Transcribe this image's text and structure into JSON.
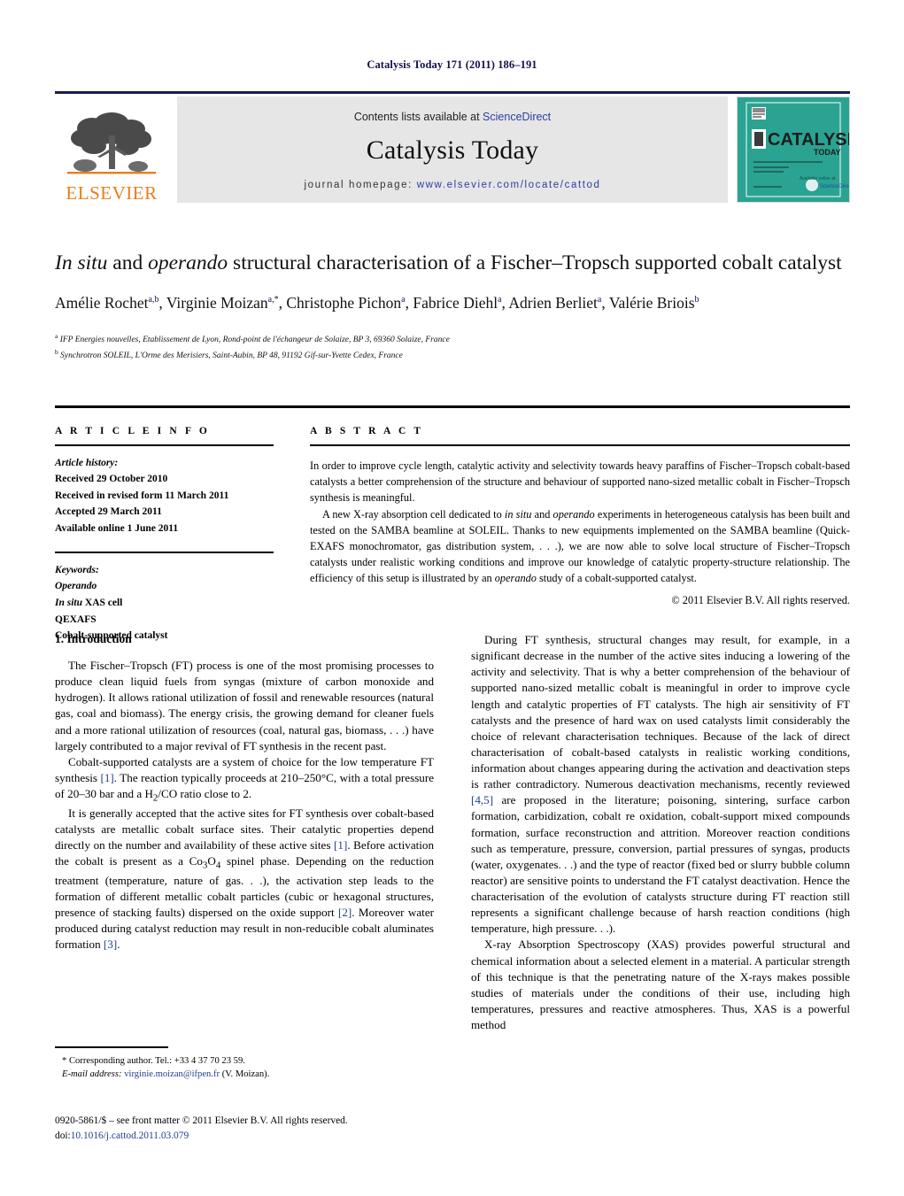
{
  "running_head": "Catalysis Today 171 (2011) 186–191",
  "masthead": {
    "contents_prefix": "Contents lists available at ",
    "contents_link": "ScienceDirect",
    "journal_title": "Catalysis Today",
    "homepage_prefix": "journal homepage: ",
    "homepage_link": "www.elsevier.com/locate/cattod",
    "publisher_logo_text": "ELSEVIER",
    "cover": {
      "title": "CATALYSIS",
      "subtitle": "TODAY",
      "accent_color": "#2aa392"
    }
  },
  "article": {
    "title_part1": "In situ",
    "title_part2": " and ",
    "title_part3": "operando",
    "title_part4": " structural characterisation of a Fischer–Tropsch supported cobalt catalyst",
    "authors": [
      {
        "name": "Amélie Rochet",
        "sup": "a,b"
      },
      {
        "name": "Virginie Moizan",
        "sup": "a,*"
      },
      {
        "name": "Christophe Pichon",
        "sup": "a"
      },
      {
        "name": "Fabrice Diehl",
        "sup": "a"
      },
      {
        "name": "Adrien Berliet",
        "sup": "a"
      },
      {
        "name": "Valérie Briois",
        "sup": "b"
      }
    ],
    "affiliations": [
      {
        "marker": "a",
        "text": "IFP Energies nouvelles, Etablissement de Lyon, Rond-point de l'échangeur de Solaize, BP 3, 69360 Solaize, France"
      },
      {
        "marker": "b",
        "text": "Synchrotron SOLEIL, L'Orme des Merisiers, Saint-Aubin, BP 48, 91192 Gif-sur-Yvette Cedex, France"
      }
    ]
  },
  "article_info": {
    "heading": "A R T I C L E   I N F O",
    "history_label": "Article history:",
    "history": [
      "Received 29 October 2010",
      "Received in revised form 11 March 2011",
      "Accepted 29 March 2011",
      "Available online 1 June 2011"
    ],
    "keywords_label": "Keywords:",
    "keywords": [
      {
        "text": "Operando",
        "italic": true
      },
      {
        "text": "In situ XAS cell",
        "italic": false,
        "lead_italic": "In situ",
        "rest": " XAS cell"
      },
      {
        "text": "QEXAFS",
        "italic": false
      },
      {
        "text": "Cobalt-supported catalyst",
        "italic": false
      }
    ]
  },
  "abstract": {
    "heading": "A B S T R A C T",
    "paragraph1": "In order to improve cycle length, catalytic activity and selectivity towards heavy paraffins of Fischer–Tropsch cobalt-based catalysts a better comprehension of the structure and behaviour of supported nano-sized metallic cobalt in Fischer–Tropsch synthesis is meaningful.",
    "paragraph2_a": "A new X-ray absorption cell dedicated to ",
    "paragraph2_it1": "in situ",
    "paragraph2_b": " and ",
    "paragraph2_it2": "operando",
    "paragraph2_c": " experiments in heterogeneous catalysis has been built and tested on the SAMBA beamline at SOLEIL. Thanks to new equipments implemented on the SAMBA beamline (Quick-EXAFS monochromator, gas distribution system, . . .), we are now able to solve local structure of Fischer–Tropsch catalysts under realistic working conditions and improve our knowledge of catalytic property-structure relationship. The efficiency of this setup is illustrated by an ",
    "paragraph2_it3": "operando",
    "paragraph2_d": " study of a cobalt-supported catalyst.",
    "copyright": "© 2011 Elsevier B.V. All rights reserved."
  },
  "body": {
    "section_title": "1.  Introduction",
    "left_p1": "The Fischer–Tropsch (FT) process is one of the most promising processes to produce clean liquid fuels from syngas (mixture of carbon monoxide and hydrogen). It allows rational utilization of fossil and renewable resources (natural gas, coal and biomass). The energy crisis, the growing demand for cleaner fuels and a more rational utilization of resources (coal, natural gas, biomass, . . .) have largely contributed to a major revival of FT synthesis in the recent past.",
    "left_p2_a": "Cobalt-supported catalysts are a system of choice for the low temperature FT synthesis ",
    "left_p2_ref1": "[1]",
    "left_p2_b": ". The reaction typically proceeds at 210–250",
    "left_p2_deg": "°C",
    "left_p2_c": ", with a total pressure of 20–30 bar and a H",
    "left_p2_sub": "2",
    "left_p2_d": "/CO ratio close to 2.",
    "left_p3_a": "It is generally accepted that the active sites for FT synthesis over cobalt-based catalysts are metallic cobalt surface sites. Their catalytic properties depend directly on the number and availability of these active sites ",
    "left_p3_ref1": "[1]",
    "left_p3_b": ". Before activation the cobalt is present as a Co",
    "left_p3_sub1": "3",
    "left_p3_c": "O",
    "left_p3_sub2": "4",
    "left_p3_d": " spinel phase. Depending on the reduction treatment (temperature, nature of gas. . .), the activation step leads to the formation of different metallic cobalt particles (cubic or hexagonal structures, presence of stacking faults) dispersed on the oxide support ",
    "left_p3_ref2": "[2]",
    "left_p3_e": ". Moreover water produced during catalyst reduction may result in non-reducible cobalt aluminates formation ",
    "left_p3_ref3": "[3]",
    "left_p3_f": ".",
    "right_p1_a": "During FT synthesis, structural changes may result, for example, in a significant decrease in the number of the active sites inducing a lowering of the activity and selectivity. That is why a better comprehension of the behaviour of supported nano-sized metallic cobalt is meaningful in order to improve cycle length and catalytic properties of FT catalysts. The high air sensitivity of FT catalysts and the presence of hard wax on used catalysts limit considerably the choice of relevant characterisation techniques. Because of the lack of direct characterisation of cobalt-based catalysts in realistic working conditions, information about changes appearing during the activation and deactivation steps is rather contradictory. Numerous deactivation mechanisms, recently reviewed ",
    "right_p1_ref": "[4,5]",
    "right_p1_b": " are proposed in the literature; poisoning, sintering, surface carbon formation, carbidization, cobalt re oxidation, cobalt-support mixed compounds formation, surface reconstruction and attrition. Moreover reaction conditions such as temperature, pressure, conversion, partial pressures of syngas, products (water, oxygenates. . .) and the type of reactor (fixed bed or slurry bubble column reactor) are sensitive points to understand the FT catalyst deactivation. Hence the characterisation of the evolution of catalysts structure during FT reaction still represents a significant challenge because of harsh reaction conditions (high temperature, high pressure. . .).",
    "right_p2": "X-ray Absorption Spectroscopy (XAS) provides powerful structural and chemical information about a selected element in a material. A particular strength of this technique is that the penetrating nature of the X-rays makes possible studies of materials under the conditions of their use, including high temperatures, pressures and reactive atmospheres. Thus, XAS is a powerful method"
  },
  "footnote": {
    "star": "*",
    "corresponding": " Corresponding author. Tel.: +33 4 37 70 23 59.",
    "email_label": "E-mail address:",
    "email": "virginie.moizan@ifpen.fr",
    "email_suffix": " (V. Moizan)."
  },
  "footer": {
    "issn_line": "0920-5861/$ – see front matter © 2011 Elsevier B.V. All rights reserved.",
    "doi_label": "doi:",
    "doi": "10.1016/j.cattod.2011.03.079"
  }
}
